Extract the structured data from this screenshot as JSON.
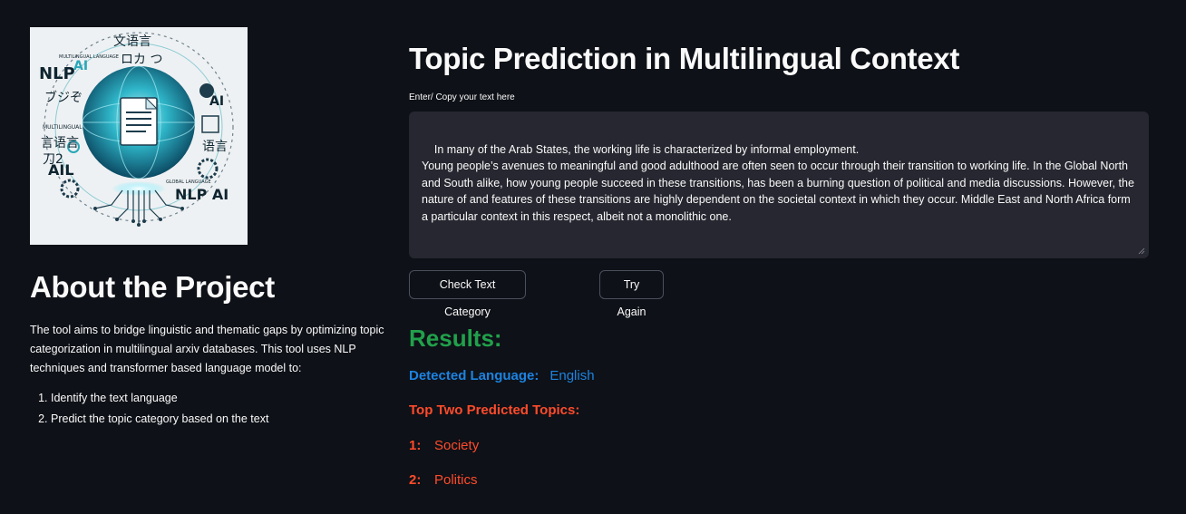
{
  "sidebar": {
    "logo_words": [
      "NLP",
      "AI",
      "AIL",
      "NLP AI",
      "AI",
      "MULTILINGUAL LANGUAGE",
      "MULTILINGUAL",
      "GLOBAL LANGUAGE"
    ],
    "about_title": "About the Project",
    "about_description": "The tool aims to bridge linguistic and thematic gaps by optimizing topic categorization in multilingual arxiv databases. This tool uses NLP techniques and transformer based language model to:",
    "about_list": [
      "Identify the text language",
      "Predict the topic category based on the text"
    ]
  },
  "main": {
    "title": "Topic Prediction in Multilingual Context",
    "input_label": "Enter/ Copy your text here",
    "input_text": "In many of the Arab States, the working life is characterized by informal employment.\nYoung people’s avenues to meaningful and good adulthood are often seen to occur through their transition to working life. In the Global North and South alike, how young people succeed in these transitions, has been a burning question of political and media discussions. However, the nature of and features of these transitions are highly dependent on the societal context in which they occur. Middle East and North Africa form a particular context in this respect, albeit not a monolithic one.",
    "check_button_label": "Check Text Category",
    "retry_button_label": "Try Again",
    "results_title": "Results:",
    "detected_language_label": "Detected Language:",
    "detected_language_value": "English",
    "topics_title": "Top Two Predicted Topics:",
    "topics": [
      {
        "rank": "1:",
        "label": "Society"
      },
      {
        "rank": "2:",
        "label": "Politics"
      }
    ]
  },
  "colors": {
    "background": "#0e1117",
    "input_background": "#262730",
    "results_green": "#21a04b",
    "language_blue": "#1c83e1",
    "topics_red": "#ff4b2b"
  }
}
